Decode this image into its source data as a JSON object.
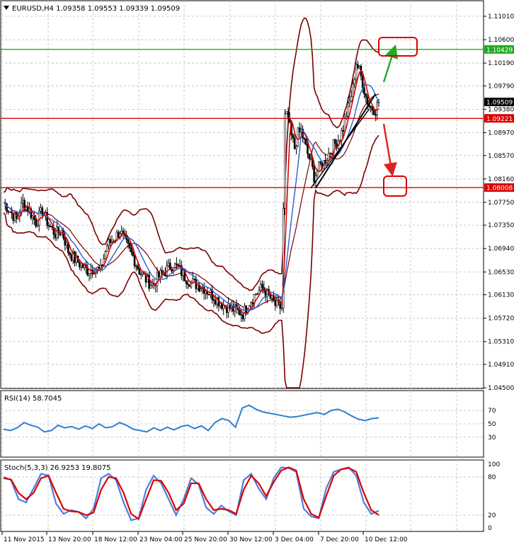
{
  "window": {
    "symbol_line": "EURUSD,H4  1.09358 1.09553 1.09339 1.09509",
    "menu_icon": "triangle-down-icon"
  },
  "colors": {
    "background": "#ffffff",
    "grid": "#c8c8c8",
    "candle": "#000000",
    "bollinger": "#7a0000",
    "ma_fast": "#e00000",
    "ma_slow": "#2a5fd6",
    "rsi": "#2f7fd0",
    "stoch_main": "#4a7fe0",
    "stoch_signal": "#dd0000",
    "level_green": "#22aa22",
    "level_red": "#dd0000",
    "arrow_green": "#22aa22",
    "arrow_red": "#dd2222",
    "trendline": "#000000",
    "current_price_bg": "#000000"
  },
  "price_axis": {
    "ticks": [
      "1.11010",
      "1.10600",
      "1.10190",
      "1.09790",
      "1.09380",
      "1.08970",
      "1.08570",
      "1.08160",
      "1.07750",
      "1.07350",
      "1.06940",
      "1.06530",
      "1.06130",
      "1.05720",
      "1.05310",
      "1.04910",
      "1.04500"
    ],
    "level_green_label": "1.10429",
    "current_price_label": "1.09509",
    "level_red_upper_label": "1.09221",
    "level_red_lower_label": "1.08008"
  },
  "rsi_panel": {
    "title": "RSI(14) 58.7045",
    "ticks": [
      "70",
      "50",
      "30"
    ]
  },
  "stoch_panel": {
    "title": "Stoch(5,3,3) 26.9253 19.8075",
    "ticks": [
      "100",
      "80",
      "20",
      "0"
    ]
  },
  "time_axis": {
    "labels": [
      "11 Nov 2015",
      "13 Nov 20:00",
      "18 Nov 12:00",
      "23 Nov 04:00",
      "25 Nov 20:00",
      "30 Nov 12:00",
      "3 Dec 04:00",
      "7 Dec 20:00",
      "10 Dec 12:00"
    ]
  },
  "chart_data": [
    {
      "type": "candlestick",
      "title": "EURUSD,H4  1.09358 1.09553 1.09339 1.09509",
      "x_labels": [
        "11 Nov 2015",
        "13 Nov 20:00",
        "18 Nov 12:00",
        "23 Nov 04:00",
        "25 Nov 20:00",
        "30 Nov 12:00",
        "3 Dec 04:00",
        "7 Dec 20:00",
        "10 Dec 12:00"
      ],
      "ylim": [
        1.044,
        1.112
      ],
      "y_ticks": [
        1.1101,
        1.106,
        1.1019,
        1.0979,
        1.0938,
        1.0897,
        1.0857,
        1.0816,
        1.0775,
        1.0735,
        1.0694,
        1.0653,
        1.0613,
        1.0572,
        1.0531,
        1.0491,
        1.045
      ],
      "current_price": 1.09509,
      "horizontal_levels": [
        {
          "price": 1.10429,
          "color": "green"
        },
        {
          "price": 1.09221,
          "color": "red"
        },
        {
          "price": 1.08008,
          "color": "red"
        }
      ],
      "close_path": [
        [
          0,
          1.0775
        ],
        [
          4,
          1.076
        ],
        [
          8,
          1.0745
        ],
        [
          12,
          1.0775
        ],
        [
          16,
          1.076
        ],
        [
          20,
          1.074
        ],
        [
          24,
          1.076
        ],
        [
          28,
          1.0735
        ],
        [
          32,
          1.072
        ],
        [
          36,
          1.0725
        ],
        [
          40,
          1.069
        ],
        [
          44,
          1.0675
        ],
        [
          48,
          1.0665
        ],
        [
          52,
          1.0655
        ],
        [
          56,
          1.066
        ],
        [
          60,
          1.0655
        ],
        [
          64,
          1.07
        ],
        [
          68,
          1.071
        ],
        [
          72,
          1.0725
        ],
        [
          76,
          1.07
        ],
        [
          80,
          1.068
        ],
        [
          84,
          1.0655
        ],
        [
          88,
          1.064
        ],
        [
          92,
          1.063
        ],
        [
          96,
          1.0645
        ],
        [
          100,
          1.0655
        ],
        [
          104,
          1.0665
        ],
        [
          108,
          1.066
        ],
        [
          112,
          1.0645
        ],
        [
          116,
          1.0635
        ],
        [
          120,
          1.063
        ],
        [
          124,
          1.0625
        ],
        [
          128,
          1.0615
        ],
        [
          132,
          1.0605
        ],
        [
          136,
          1.0595
        ],
        [
          140,
          1.059
        ],
        [
          144,
          1.0585
        ],
        [
          148,
          1.058
        ],
        [
          152,
          1.06
        ],
        [
          156,
          1.0615
        ],
        [
          160,
          1.0625
        ],
        [
          164,
          1.061
        ],
        [
          168,
          1.0595
        ],
        [
          172,
          1.059
        ],
        [
          174,
          1.093
        ],
        [
          176,
          1.092
        ],
        [
          178,
          1.089
        ],
        [
          180,
          1.087
        ],
        [
          182,
          1.0895
        ],
        [
          184,
          1.09
        ],
        [
          186,
          1.088
        ],
        [
          188,
          1.086
        ],
        [
          190,
          1.0845
        ],
        [
          192,
          1.082
        ],
        [
          194,
          1.083
        ],
        [
          196,
          1.084
        ],
        [
          198,
          1.0845
        ],
        [
          200,
          1.0855
        ],
        [
          202,
          1.0865
        ],
        [
          204,
          1.0875
        ],
        [
          206,
          1.088
        ],
        [
          208,
          1.089
        ],
        [
          210,
          1.0905
        ],
        [
          212,
          1.093
        ],
        [
          214,
          1.095
        ],
        [
          216,
          1.0975
        ],
        [
          218,
          1.102
        ],
        [
          220,
          1.1005
        ],
        [
          222,
          1.0985
        ],
        [
          224,
          1.096
        ],
        [
          226,
          1.0945
        ],
        [
          228,
          1.094
        ],
        [
          230,
          1.0938
        ],
        [
          232,
          1.0951
        ]
      ],
      "indicators": [
        "Bollinger Bands (upper/middle/lower)",
        "Moving average fast (red)",
        "Moving average slow (blue)",
        "Support trendline (black)"
      ]
    },
    {
      "type": "line",
      "title": "RSI(14) 58.7045",
      "ylim": [
        0,
        100
      ],
      "y_ticks": [
        70,
        50,
        30
      ],
      "series": [
        {
          "name": "RSI(14)",
          "values": [
            42,
            40,
            44,
            52,
            48,
            45,
            38,
            40,
            48,
            44,
            46,
            42,
            47,
            43,
            50,
            44,
            46,
            52,
            48,
            42,
            40,
            38,
            44,
            40,
            45,
            41,
            46,
            48,
            43,
            47,
            40,
            52,
            58,
            55,
            45,
            74,
            78,
            72,
            68,
            66,
            64,
            62,
            60,
            61,
            63,
            65,
            67,
            64,
            70,
            72,
            68,
            62,
            57,
            55,
            58,
            59
          ]
        }
      ]
    },
    {
      "type": "line",
      "title": "Stoch(5,3,3) 26.9253 19.8075",
      "ylim": [
        0,
        100
      ],
      "y_ticks": [
        100,
        80,
        20,
        0
      ],
      "series": [
        {
          "name": "Stoch main",
          "values": [
            80,
            75,
            45,
            40,
            62,
            85,
            82,
            38,
            22,
            28,
            25,
            15,
            30,
            78,
            85,
            75,
            40,
            12,
            15,
            60,
            82,
            70,
            45,
            20,
            45,
            78,
            68,
            32,
            22,
            35,
            26,
            20,
            75,
            85,
            62,
            45,
            78,
            95,
            94,
            88,
            30,
            18,
            15,
            62,
            88,
            92,
            95,
            82,
            40,
            22,
            27
          ]
        },
        {
          "name": "Stoch signal",
          "values": [
            78,
            76,
            55,
            45,
            55,
            78,
            82,
            55,
            30,
            26,
            25,
            20,
            24,
            60,
            80,
            78,
            55,
            22,
            14,
            45,
            75,
            74,
            55,
            28,
            38,
            70,
            70,
            45,
            28,
            30,
            28,
            22,
            60,
            82,
            70,
            50,
            72,
            90,
            95,
            90,
            45,
            22,
            16,
            50,
            82,
            92,
            94,
            88,
            55,
            28,
            20
          ]
        }
      ]
    }
  ]
}
